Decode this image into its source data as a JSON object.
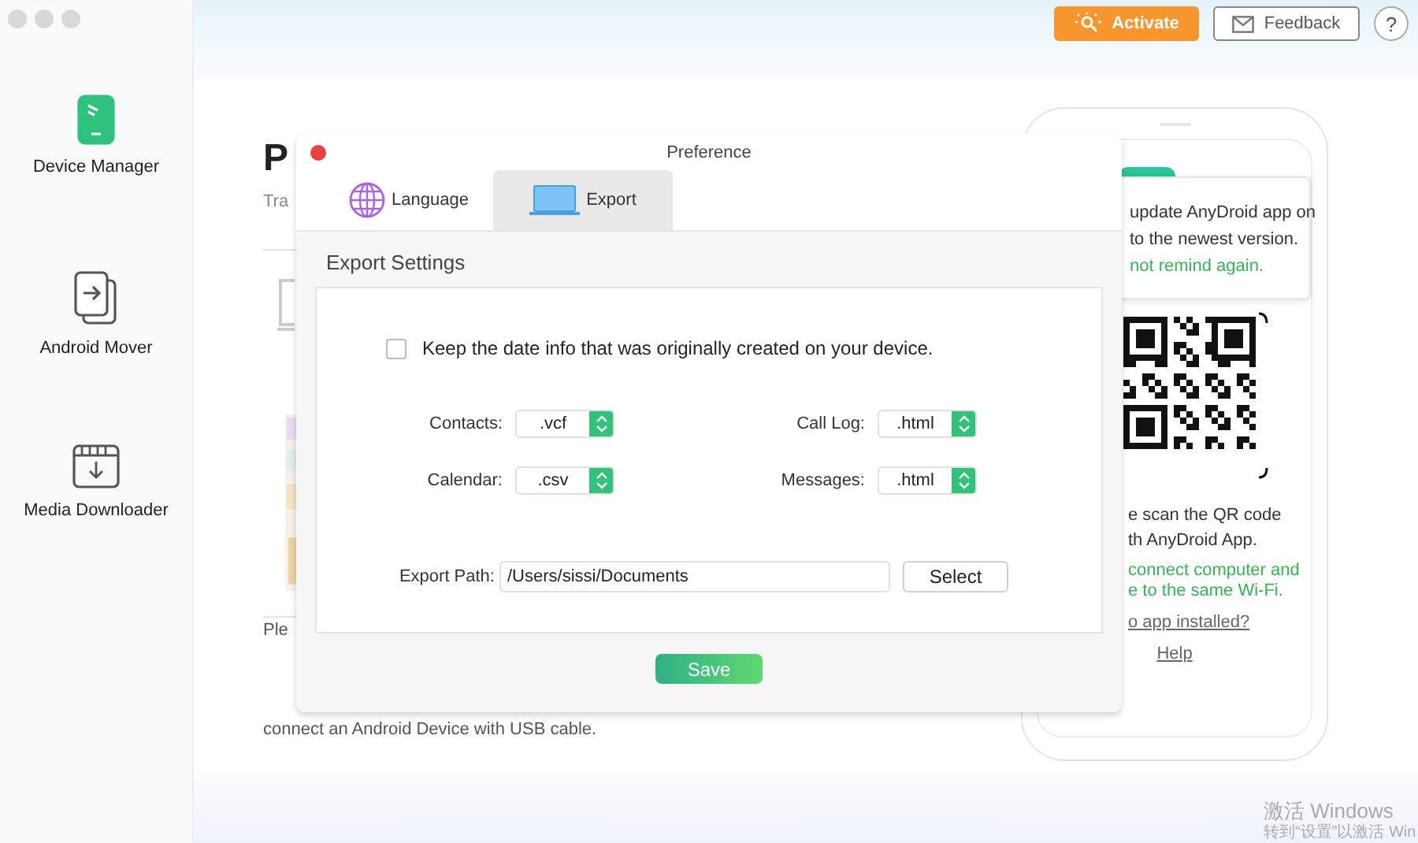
{
  "sidebar": {
    "items": [
      {
        "label": "Device Manager",
        "kind": "device",
        "selected": true
      },
      {
        "label": "Android Mover",
        "kind": "mover",
        "selected": false
      },
      {
        "label": "Media Downloader",
        "kind": "downloader",
        "selected": false
      }
    ]
  },
  "header": {
    "activate": "Activate",
    "feedback": "Feedback",
    "help": "?"
  },
  "page": {
    "title": "P",
    "subtitle": "Tra",
    "hint_lines": [
      "Ple",
      "connect an Android Device with USB cable."
    ]
  },
  "phone": {
    "tooltip_lines": [
      "update AnyDroid app on",
      "to the newest version."
    ],
    "tooltip_link": "not remind again.",
    "scan_lines": [
      "e scan the QR code",
      "th AnyDroid App."
    ],
    "wifi_lines": [
      "connect computer and",
      "e to the same Wi-Fi."
    ],
    "no_app_link": "o app installed?",
    "help_link": "Help"
  },
  "dialog": {
    "title": "Preference",
    "tabs": [
      {
        "label": "Language",
        "kind": "language",
        "selected": false
      },
      {
        "label": "Export",
        "kind": "export",
        "selected": true
      }
    ],
    "section_title": "Export Settings",
    "keep_date": {
      "label": "Keep the date info that was originally created on your device.",
      "checked": false
    },
    "formats": [
      {
        "label": "Contacts:",
        "value": ".vcf"
      },
      {
        "label": "Call Log:",
        "value": ".html"
      },
      {
        "label": "Calendar:",
        "value": ".csv"
      },
      {
        "label": "Messages:",
        "value": ".html"
      }
    ],
    "export_path": {
      "label": "Export Path:",
      "value": "/Users/sissi/Documents"
    },
    "select_button": "Select",
    "save_button": "Save"
  },
  "os_notice": [
    "激活 Windows",
    "转到“设置”以激活 Win"
  ]
}
